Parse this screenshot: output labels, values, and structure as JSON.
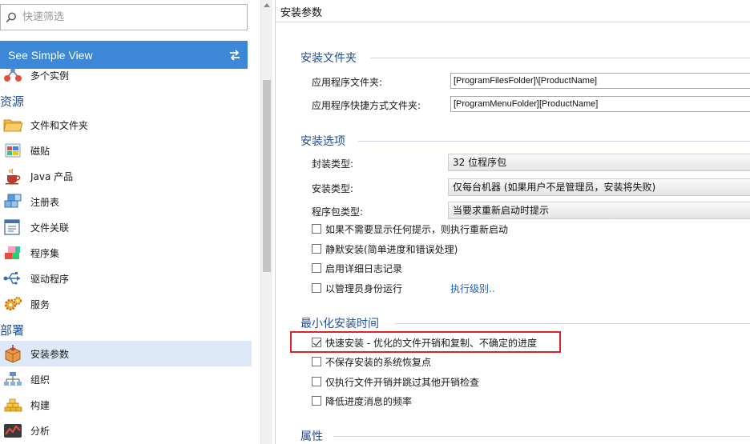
{
  "sidebar": {
    "search_placeholder": "快速筛选",
    "simple_view_label": "See Simple View",
    "partial_item_label": "多个实例",
    "groups": {
      "resources": "资源",
      "deploy": "部署"
    },
    "items": {
      "files": "文件和文件夹",
      "tiles": "磁贴",
      "java": "Java 产品",
      "registry": "注册表",
      "file_assoc": "文件关联",
      "assemblies": "程序集",
      "drivers": "驱动程序",
      "services": "服务",
      "install_params": "安装参数",
      "organization": "组织",
      "build": "构建",
      "analysis": "分析"
    }
  },
  "panel": {
    "title": "安装参数",
    "sections": {
      "install_folder": "安装文件夹",
      "install_options": "安装选项",
      "minimal_install": "最小化安装时间",
      "properties": "属性"
    },
    "folder": {
      "app_folder_label": "应用程序文件夹:",
      "app_folder_value": "[ProgramFilesFolder]\\[ProductName]",
      "shortcut_folder_label": "应用程序快捷方式文件夹:",
      "shortcut_folder_value": "[ProgramMenuFolder][ProductName]"
    },
    "options": {
      "package_type_label": "封装类型:",
      "package_type_value": "32 位程序包",
      "install_type_label": "安装类型:",
      "install_type_value": "仅每台机器 (如果用户不是管理员，安装将失败)",
      "package_kind_label": "程序包类型:",
      "package_kind_value": "当要求重新启动时提示",
      "cb_reboot": "如果不需要显示任何提示，则执行重新启动",
      "cb_silent": "静默安装(简单进度和错误处理)",
      "cb_verbose_log": "启用详细日志记录",
      "cb_run_as_admin": "以管理员身份运行",
      "exec_level_link": "执行级别.."
    },
    "minimal": {
      "cb_fast_install": "快速安装 - 优化的文件开销和复制、不确定的进度",
      "cb_no_restore_point": "不保存安装的系统恢复点",
      "cb_costing_only": "仅执行文件开销并跳过其他开销检查",
      "cb_reduce_progress": "降低进度消息的频率"
    },
    "checked_state": {
      "cb_reboot": false,
      "cb_silent": false,
      "cb_verbose_log": false,
      "cb_run_as_admin": false,
      "cb_fast_install": true,
      "cb_no_restore_point": false,
      "cb_costing_only": false,
      "cb_reduce_progress": false
    }
  },
  "colors": {
    "accent_blue": "#3c87d8",
    "section_title": "#1f4e96",
    "selected_item": "#dde9f8",
    "link": "#1c62c8",
    "highlight_border": "#d9262a"
  },
  "icons": {
    "search": "magnifier-icon",
    "swap": "swap-arrows-icon",
    "multi_instance": "multi-instance-icon",
    "files": "folder-icon",
    "tiles": "tiles-icon",
    "java": "java-cup-icon",
    "registry": "registry-cubes-icon",
    "file_assoc": "file-association-icon",
    "assemblies": "assembly-blocks-icon",
    "drivers": "usb-driver-icon",
    "services": "gears-icon",
    "install_params": "install-box-icon",
    "organization": "org-chart-icon",
    "build": "build-bricks-icon",
    "analysis": "analysis-chart-icon"
  }
}
